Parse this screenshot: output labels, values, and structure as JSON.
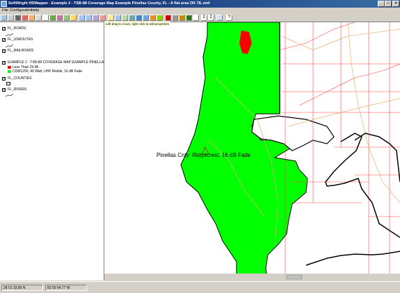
{
  "window": {
    "title": "SoftWright HDMapper - Example 2 - TSB-88 Coverage Map Example Pinellas County, FL - A flat area OK 78..emf"
  },
  "menu": {
    "items": [
      "File",
      "Configuration",
      "Help"
    ]
  },
  "hint": "Left drag to move, right click to edit properties",
  "legend": {
    "layers": [
      {
        "name": "FL_ROADS"
      },
      {
        "name": "FL_USROUTES"
      },
      {
        "name": "FL_RAILROADS"
      },
      {
        "name": "EXAMPLE 2 - TSB-88 COVERAGE MAP EXAMPLE PINELLAS COUNT",
        "entries": [
          "Less Than 24.98",
          "CDM1250, 40 Watt, UHF Mobile, 16 dB Fade"
        ]
      },
      {
        "name": "FL_COUNTIES"
      },
      {
        "name": "FL_RIVERS"
      }
    ]
  },
  "map": {
    "site_label": "Pinellas Cnty: Ridgecrest, 16 dB Fade"
  },
  "status": {
    "lat": "28 01 33.86 N",
    "lon": "82 59 54.77 W"
  },
  "colors": {
    "coverage": "#00ff00",
    "below_threshold": "#ff0000",
    "roads": "#ff4040",
    "routes": "#e8b070"
  }
}
